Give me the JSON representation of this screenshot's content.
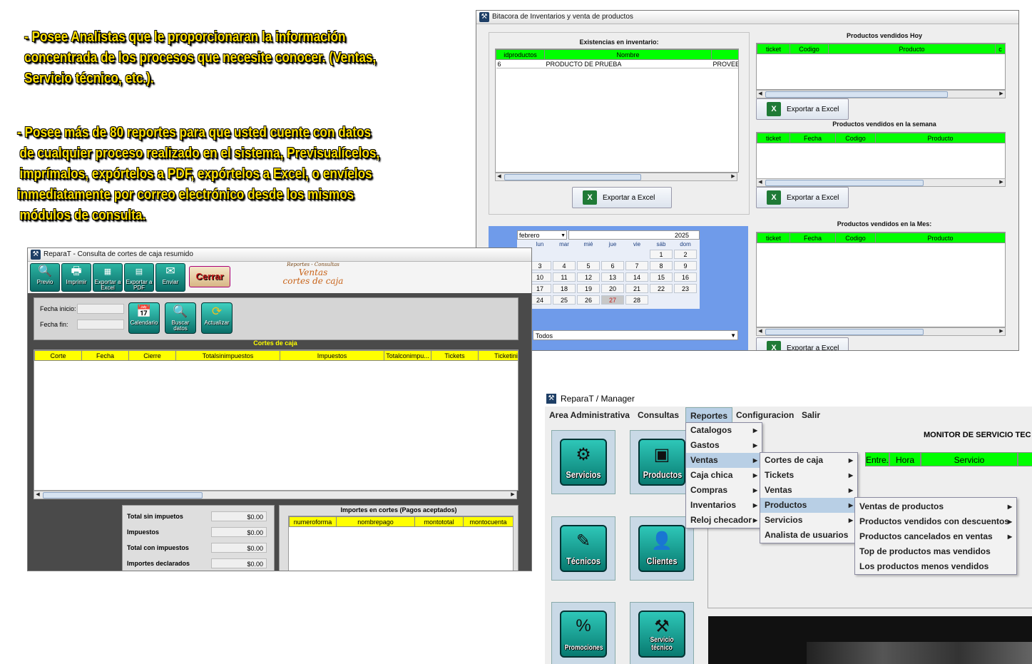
{
  "promo": {
    "block1": [
      "- Posee Analistas que le proporcionaran la información",
      "concentrada de los procesos que necesite conocer.  (Ventas,",
      "Servicio técnico, etc.)."
    ],
    "block2": [
      "- Posee más de 80 reportes para que usted cuente con datos",
      "de cualquier proceso realizado en el sistema, Previsualícelos,",
      "imprímalos, expórtelos a PDF, expórtelos a Excel, o envíelos",
      "inmediatamente por correo electrónico desde los mismos",
      "módulos de consulta."
    ]
  },
  "bitacora": {
    "title": "Bitacora de Inventarios y venta de productos",
    "existencias": {
      "title": "Existencias en inventario:",
      "columns": [
        "idproductos",
        "Nombre",
        ""
      ],
      "rows": [
        [
          "6",
          "PRODUCTO DE PRUEBA",
          "PROVEE"
        ]
      ],
      "export_label": "Exportar a Excel"
    },
    "hoy": {
      "title": "Productos vendidos Hoy",
      "columns": [
        "ticket",
        "Codigo",
        "Producto",
        "c"
      ],
      "export_label": "Exportar a Excel"
    },
    "semana": {
      "title": "Productos vendidos en la semana",
      "columns": [
        "ticket",
        "Fecha",
        "Codigo",
        "Producto"
      ],
      "export_label": "Exportar a Excel"
    },
    "mes": {
      "title": "Productos vendidos en la Mes:",
      "columns": [
        "ticket",
        "Fecha",
        "Codigo",
        "Producto"
      ],
      "export_label": "Exportar a Excel"
    },
    "calendar": {
      "month": "febrero",
      "year": "2025",
      "dow": [
        "lun",
        "mar",
        "mié",
        "jue",
        "vie",
        "sáb",
        "dom"
      ],
      "weeks": [
        [
          "",
          "",
          "",
          "",
          "",
          "1",
          "2"
        ],
        [
          "3",
          "4",
          "5",
          "6",
          "7",
          "8",
          "9"
        ],
        [
          "10",
          "11",
          "12",
          "13",
          "14",
          "15",
          "16"
        ],
        [
          "17",
          "18",
          "19",
          "20",
          "21",
          "22",
          "23"
        ],
        [
          "24",
          "25",
          "26",
          "27",
          "28",
          "",
          ""
        ]
      ],
      "selected_day": "27"
    },
    "filter_value": "Todos"
  },
  "cortes": {
    "title": "ReparaT - Consulta de cortes de caja resumido",
    "toolbar": [
      {
        "icon": "preview-icon",
        "label": "Previo"
      },
      {
        "icon": "printer-icon",
        "label": "Imprimir"
      },
      {
        "icon": "excel-icon",
        "label": "Exportar a Excel"
      },
      {
        "icon": "pdf-icon",
        "label": "Exportar a PDF"
      },
      {
        "icon": "mail-icon",
        "label": "Enviar"
      }
    ],
    "close_label": "Cerrar",
    "header_small": "Reportes - Consultas",
    "header_line1": "Ventas",
    "header_line2": "cortes de caja",
    "fecha_inicio_label": "Fecha inicio:",
    "fecha_fin_label": "Fecha fin:",
    "actions": [
      {
        "icon": "calendar-icon",
        "label": "Calendario"
      },
      {
        "icon": "search-icon",
        "label": "Buscar datos"
      },
      {
        "icon": "refresh-icon",
        "label": "Actualizar"
      }
    ],
    "table_title": "Cortes de caja",
    "columns": [
      "Corte",
      "Fecha",
      "Cierre",
      "Totalsinimpuestos",
      "Impuestos",
      "Totalconimpu...",
      "Tickets",
      "Ticketini"
    ],
    "totals": [
      {
        "label": "Total sin impuetos",
        "value": "$0.00"
      },
      {
        "label": "Impuestos",
        "value": "$0.00"
      },
      {
        "label": "Total con impuestos",
        "value": "$0.00"
      },
      {
        "label": "Importes declarados",
        "value": "$0.00"
      }
    ],
    "importes_title": "Importes en cortes (Pagos aceptados)",
    "importes_columns": [
      "numeroforma",
      "nombrepago",
      "montototal",
      "montocuenta"
    ]
  },
  "manager": {
    "title": "ReparaT / Manager",
    "menu": [
      "Area Administrativa",
      "Consultas",
      "Reportes",
      "Configuracion",
      "Salir"
    ],
    "reportes_menu": [
      "Catalogos",
      "Gastos",
      "Ventas",
      "Caja chica",
      "Compras",
      "Inventarios",
      "Reloj checador"
    ],
    "ventas_menu": [
      "Cortes de caja",
      "Tickets",
      "Ventas",
      "Productos",
      "Servicios",
      "Analista de usuarios"
    ],
    "productos_menu": [
      "Ventas de productos",
      "Productos vendidos con descuentos",
      "Productos cancelados en ventas",
      "Top de productos mas vendidos",
      "Los productos menos vendidos"
    ],
    "monitor_title": "MONITOR DE SERVICIO TEC",
    "monitor_columns": [
      "Entre...",
      "Hora",
      "Servicio"
    ],
    "buttons": [
      {
        "icon": "gear-icon",
        "label": "Servicios"
      },
      {
        "icon": "box-icon",
        "label": "Productos"
      },
      {
        "icon": "screwdriver-icon",
        "label": "Técnicos"
      },
      {
        "icon": "person-icon",
        "label": "Clientes"
      },
      {
        "icon": "tag-percent-icon",
        "label": "Promociones"
      },
      {
        "icon": "tools-icon",
        "label": "Servicio técnico"
      }
    ]
  }
}
